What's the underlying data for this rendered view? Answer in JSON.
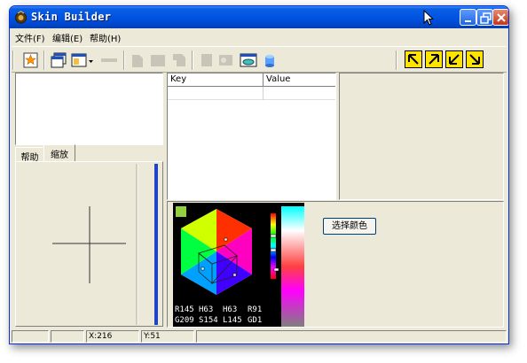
{
  "window": {
    "title": "Skin Builder"
  },
  "menu": [
    {
      "label": "文件(F)"
    },
    {
      "label": "编辑(E)"
    },
    {
      "label": "帮助(H)"
    }
  ],
  "tabs": [
    {
      "label": "帮助"
    },
    {
      "label": "缩放"
    }
  ],
  "grid": {
    "columns": [
      "Key",
      "Value"
    ]
  },
  "color_panel": {
    "button_label": "选择颜色",
    "readout": [
      [
        "R145",
        "H63",
        "H63",
        "R91"
      ],
      [
        "G209",
        "S154",
        "L145",
        "GD1"
      ]
    ],
    "swatch_color": "#91d13f"
  },
  "statusbar": {
    "x": "X:216",
    "y": "Y:51"
  },
  "colors": {
    "title_blue": "#0054e3",
    "face": "#ece9d8",
    "accent_yellow": "#ffe400"
  }
}
